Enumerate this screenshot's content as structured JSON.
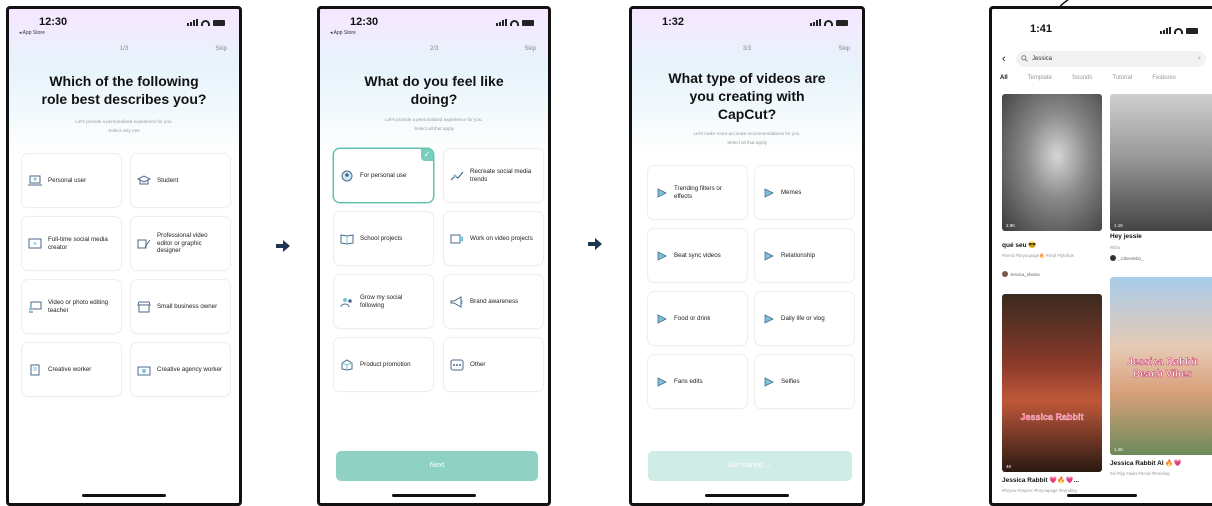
{
  "arrows": {
    "glyph": "➡",
    "color": "#1f3552"
  },
  "screen1": {
    "status": {
      "time": "12:30",
      "back": "◂ App Store"
    },
    "step": "1/3",
    "skip": "Skip",
    "title_line1": "Which of the following",
    "title_line2": "role best describes you?",
    "subtitle_line1": "Let's provide a personalized experience for you.",
    "subtitle_line2": "Select only one",
    "options": [
      {
        "label": "Personal user",
        "icon": "laptop-user-icon"
      },
      {
        "label": "Student",
        "icon": "graduation-cap-icon"
      },
      {
        "label": "Full-time social media creator",
        "icon": "video-screen-icon"
      },
      {
        "label": "Professional video editor or graphic designer",
        "icon": "pen-tool-icon"
      },
      {
        "label": "Video or photo editing teacher",
        "icon": "teacher-board-icon"
      },
      {
        "label": "Small business owner",
        "icon": "storefront-icon"
      },
      {
        "label": "Creative worker",
        "icon": "document-icon"
      },
      {
        "label": "Creative agency worker",
        "icon": "agency-icon"
      }
    ]
  },
  "screen2": {
    "status": {
      "time": "12:30",
      "back": "◂ App Store"
    },
    "step": "2/3",
    "skip": "Skip",
    "title_line1": "What do you feel like",
    "title_line2": "doing?",
    "subtitle_line1": "Let's provide a personalized experience for you.",
    "subtitle_line2": "Select all that apply",
    "options": [
      {
        "label": "For personal use",
        "icon": "person-icon",
        "selected": true
      },
      {
        "label": "Recreate social media trends",
        "icon": "trend-icon",
        "selected": false
      },
      {
        "label": "School projects",
        "icon": "book-icon",
        "selected": false
      },
      {
        "label": "Work on video projects",
        "icon": "video-project-icon",
        "selected": false
      },
      {
        "label": "Grow my social following",
        "icon": "followers-icon",
        "selected": false
      },
      {
        "label": "Brand awareness",
        "icon": "megaphone-icon",
        "selected": false
      },
      {
        "label": "Product promotion",
        "icon": "product-icon",
        "selected": false
      },
      {
        "label": "Other",
        "icon": "other-icon",
        "selected": false
      }
    ],
    "button": "Next"
  },
  "screen3": {
    "status": {
      "time": "1:32"
    },
    "step": "3/3",
    "skip": "Skip",
    "title_line1": "What type of videos are",
    "title_line2": "you creating with",
    "title_line3": "CapCut?",
    "subtitle_line1": "Let's make more accurate recommendations for you.",
    "subtitle_line2": "Select all that apply",
    "options": [
      {
        "label": "Trending filters or effects",
        "icon": "play-icon"
      },
      {
        "label": "Memes",
        "icon": "play-icon"
      },
      {
        "label": "Beat sync videos",
        "icon": "play-icon"
      },
      {
        "label": "Relationship",
        "icon": "play-icon"
      },
      {
        "label": "Food or drink",
        "icon": "play-icon"
      },
      {
        "label": "Daily life or vlog",
        "icon": "play-icon"
      },
      {
        "label": "Fans edits",
        "icon": "play-icon"
      },
      {
        "label": "Selfies",
        "icon": "play-icon"
      }
    ],
    "button": "Get started  →"
  },
  "screen4": {
    "status": {
      "time": "1:41"
    },
    "search_query": "Jessica",
    "tabs": [
      "All",
      "Template",
      "Sounds",
      "Tutorial",
      "Features"
    ],
    "active_tab": "All",
    "results": [
      {
        "title": "qué seu 😎",
        "tags": "#trend #foryoupage🔥 #viral #fyfollow",
        "author": "Jessica_ebeina",
        "stat": "2.8K"
      },
      {
        "title": "Hey jessie",
        "tags": "#Ebu",
        "author": "_JJbeentDo_",
        "stat": "1.1K"
      },
      {
        "title": "Jessica Rabbit 💗🔥💗...",
        "tags": "#foryou #capcut #foryoupage #trending",
        "author": "",
        "stat": "4K",
        "overlay": "Jessica Rabbit"
      },
      {
        "title": "Jessica Rabbit AI 🔥💗",
        "tags": "#ai #fyp #aiart #trend #trending",
        "author": "",
        "stat": "1.2K",
        "overlay_line1": "Jessica Rabbit",
        "overlay_line2": "Beach Vibes"
      }
    ]
  }
}
